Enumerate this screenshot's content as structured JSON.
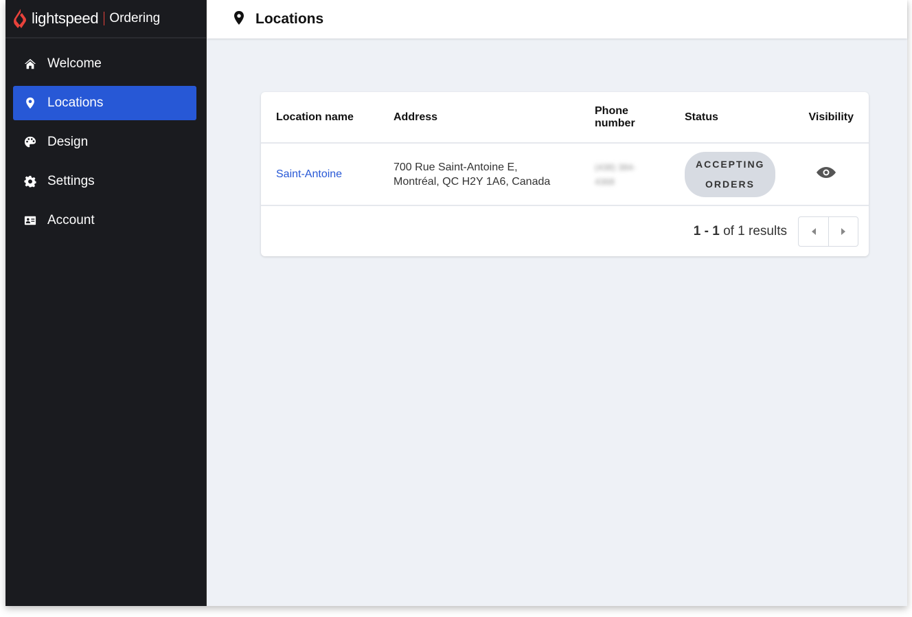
{
  "brand": {
    "name": "lightspeed",
    "product": "Ordering",
    "accent_color": "#e8423b"
  },
  "sidebar": {
    "items": [
      {
        "label": "Welcome",
        "icon": "home-icon",
        "active": false
      },
      {
        "label": "Locations",
        "icon": "map-pin-icon",
        "active": true
      },
      {
        "label": "Design",
        "icon": "palette-icon",
        "active": false
      },
      {
        "label": "Settings",
        "icon": "gear-icon",
        "active": false
      },
      {
        "label": "Account",
        "icon": "id-card-icon",
        "active": false
      }
    ],
    "active_color": "#2758d6"
  },
  "header": {
    "title": "Locations",
    "icon": "map-pin-icon"
  },
  "table": {
    "columns": {
      "name": "Location name",
      "address": "Address",
      "phone": "Phone number",
      "status": "Status",
      "visibility": "Visibility"
    },
    "rows": [
      {
        "name": "Saint-Antoine",
        "address_line1": "700 Rue Saint-Antoine E,",
        "address_line2": "Montréal, QC H2Y 1A6, Canada",
        "phone_line1": "(438) 384-",
        "phone_line2": "4368",
        "status": "ACCEPTING ORDERS",
        "visibility": "visible",
        "visibility_icon": "eye-icon"
      }
    ]
  },
  "pagination": {
    "range": "1 - 1",
    "of_text": "of 1 results",
    "prev_icon": "caret-left-icon",
    "next_icon": "caret-right-icon"
  }
}
